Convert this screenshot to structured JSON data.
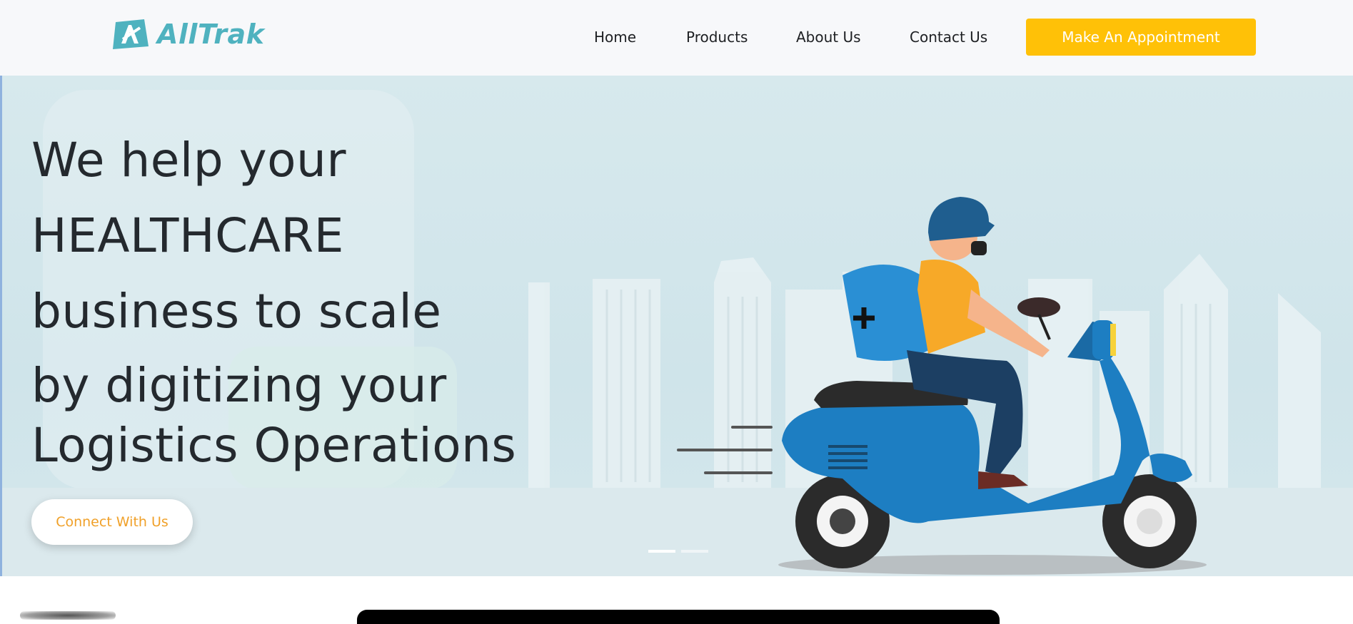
{
  "brand": {
    "name": "AllTrak",
    "color": "#4fb2bf"
  },
  "nav": {
    "items": [
      {
        "label": "Home"
      },
      {
        "label": "Products"
      },
      {
        "label": "About Us"
      },
      {
        "label": "Contact Us"
      }
    ],
    "cta_label": "Make An Appointment",
    "cta_color": "#ffc107"
  },
  "hero": {
    "lines": [
      "We help your",
      "HEALTHCARE",
      "business to scale",
      "by digitizing your",
      "Logistics Operations"
    ],
    "button_label": "Connect With Us",
    "button_text_color": "#f0a028",
    "carousel": {
      "slides": 2,
      "active": 1
    },
    "illustration": "delivery-rider-on-scooter"
  }
}
